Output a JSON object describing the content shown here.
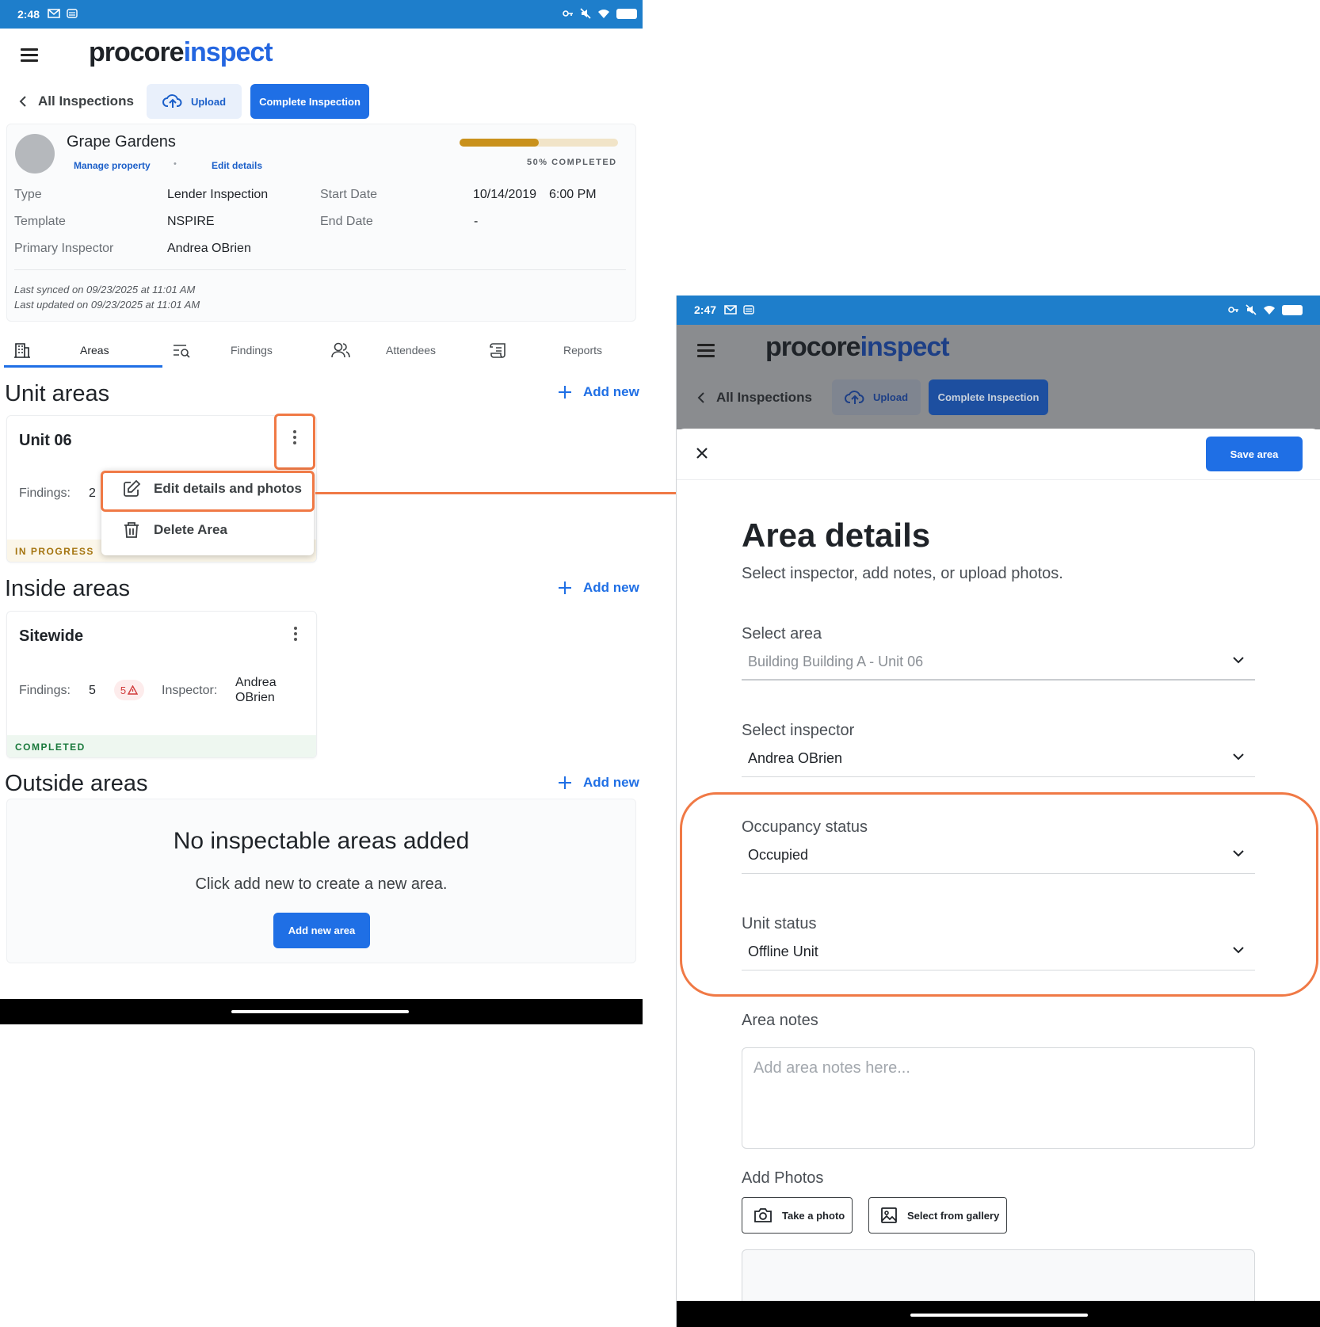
{
  "left": {
    "status": {
      "time": "2:48"
    },
    "logo": {
      "part1": "procore",
      "part2": "inspect"
    },
    "toolbar": {
      "back_label": "All Inspections",
      "upload_label": "Upload",
      "complete_label": "Complete Inspection"
    },
    "property": {
      "name": "Grape Gardens",
      "manage_link": "Manage property",
      "separator": "•",
      "edit_link": "Edit details",
      "progress_percent": 50,
      "progress_text": "50% COMPLETED",
      "type_label": "Type",
      "type_value": "Lender Inspection",
      "template_label": "Template",
      "template_value": "NSPIRE",
      "inspector_label": "Primary Inspector",
      "inspector_value": "Andrea OBrien",
      "start_label": "Start Date",
      "start_date": "10/14/2019",
      "start_time": "6:00 PM",
      "end_label": "End Date",
      "end_value": "-",
      "synced": "Last synced on 09/23/2025 at 11:01 AM",
      "updated": "Last updated on 09/23/2025 at 11:01 AM"
    },
    "tabs": [
      "Areas",
      "Findings",
      "Attendees",
      "Reports"
    ],
    "add_new": "Add new",
    "unit_areas": {
      "title": "Unit areas",
      "card": {
        "name": "Unit 06",
        "findings_label": "Findings:",
        "findings_value": "2",
        "status": "IN PROGRESS"
      }
    },
    "menu": {
      "edit": "Edit details and photos",
      "delete": "Delete Area"
    },
    "inside_areas": {
      "title": "Inside areas",
      "card": {
        "name": "Sitewide",
        "findings_label": "Findings:",
        "findings_value": "5",
        "alert_count": "5",
        "inspector_label": "Inspector:",
        "inspector_line1": "Andrea",
        "inspector_line2": "OBrien",
        "status": "COMPLETED"
      }
    },
    "outside_areas": {
      "title": "Outside areas",
      "empty_title": "No inspectable areas added",
      "empty_sub": "Click add new to create a new area.",
      "add_button": "Add new area"
    }
  },
  "right": {
    "status": {
      "time": "2:47"
    },
    "logo": {
      "part1": "procore",
      "part2": "inspect"
    },
    "toolbar": {
      "back_label": "All Inspections",
      "upload_label": "Upload",
      "complete_label": "Complete Inspection"
    },
    "save_label": "Save area",
    "title": "Area details",
    "subtitle": "Select inspector, add notes, or upload photos.",
    "select_area": {
      "label": "Select area",
      "value": "Building Building A - Unit 06"
    },
    "select_inspector": {
      "label": "Select inspector",
      "value": "Andrea OBrien"
    },
    "occupancy": {
      "label": "Occupancy status",
      "value": "Occupied"
    },
    "unit_status": {
      "label": "Unit status",
      "value": "Offline Unit"
    },
    "notes": {
      "label": "Area notes",
      "placeholder": "Add area notes here..."
    },
    "photos": {
      "label": "Add Photos",
      "take": "Take a photo",
      "gallery": "Select from gallery"
    }
  },
  "colors": {
    "brand_blue": "#1f6fe5",
    "status_bar": "#1e7ecb",
    "highlight": "#f07945",
    "in_progress": "#a4740f",
    "completed": "#1a7a3c",
    "alert": "#d13b3b"
  }
}
